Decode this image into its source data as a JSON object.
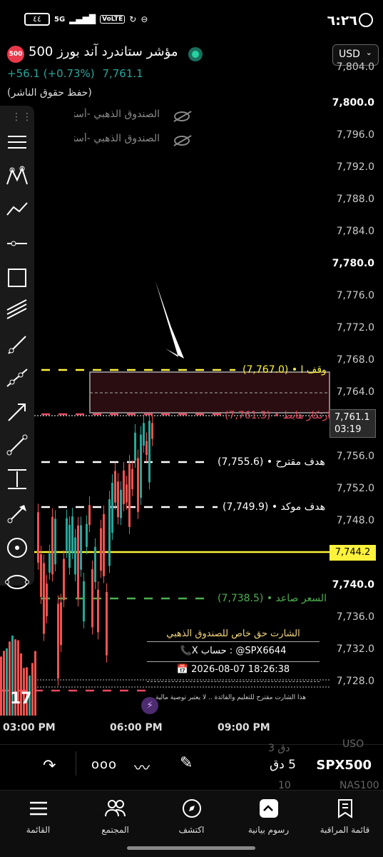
{
  "status_bar": {
    "time": "٦:٢٦",
    "battery": "٤٤",
    "network": "5G",
    "volte": "VoLTE"
  },
  "header": {
    "symbol_badge": "500",
    "title": "مؤشر ستاندرد آند بورز 500",
    "change": "+56.1 (+0.73%)",
    "price": "7,761.1",
    "copyright": "(حفظ حقوق الناشر)",
    "currency": "USD"
  },
  "indicators": [
    {
      "label": "الصندوق الذهبي -أستراتيجيا"
    },
    {
      "label": "الصندوق الذهبي -أستراتيجيا"
    }
  ],
  "toolbar": {
    "tools": [
      "menu-lines-icon",
      "pattern-icon",
      "trend-icon",
      "horizontal-line-icon",
      "rectangle-icon",
      "fib-channel-icon",
      "line-icon",
      "ray-icon",
      "arrow-icon",
      "segment-icon",
      "measure-icon",
      "arrow-marker-icon",
      "circle-target-icon",
      "ellipse-icon"
    ]
  },
  "price_scale": {
    "labels": [
      "7,804.0",
      "7,800.0",
      "7,796.0",
      "7,792.0",
      "7,788.0",
      "7,784.0",
      "7,780.0",
      "7,776.0",
      "7,772.0",
      "7,768.0",
      "7,764.0",
      "7,756.0",
      "7,752.0",
      "7,748.0",
      "7,740.0",
      "7,736.0",
      "7,732.0",
      "7,728.0"
    ],
    "bold_labels": [
      "7,800.0",
      "7,780.0",
      "7,740.0"
    ],
    "current_price": "7,761.1",
    "countdown": "03:19",
    "highlight_price": "7,744.2"
  },
  "levels": {
    "stop": {
      "label": "وقف ا • (7,767.0)",
      "value": 7767.0,
      "color": "#fff23b"
    },
    "current": {
      "label": "ارتكاز هابط • (7,761.3)",
      "value": 7761.3,
      "color": "#e84a5f"
    },
    "target_suggested": {
      "label": "هدف مقترح • (7,755.6)",
      "value": 7755.6,
      "color": "#ffffff"
    },
    "target_confirmed": {
      "label": "هدف موكد • (7,749.9)",
      "value": 7749.9,
      "color": "#ffffff"
    },
    "yellow_line": {
      "value": 7744.2,
      "color": "#fff23b"
    },
    "rising_price": {
      "label": "السعر صاعد • (7,738.5)",
      "value": 7738.5,
      "color": "#4caf50"
    }
  },
  "watermark": {
    "title": "الشارت حق خاص للصندوق الذهبي",
    "account": "📞X حساب :  @SPX6644",
    "datetime": "2026-08-07 18:26:38",
    "note": "هذا الشارت مقترح للتعليم والفائدة .. لا يعتبر توصية مالية"
  },
  "time_axis": [
    "03:00 PM",
    "06:00 PM",
    "09:00 PM"
  ],
  "bottom_panel": {
    "symbol": "SPX500",
    "interval": "5 دق",
    "ghost_items": [
      "USO",
      "3 دق",
      "NAS100",
      "10"
    ]
  },
  "nav": [
    {
      "label": "قائمة المراقبة",
      "icon": "bookmark-list-icon"
    },
    {
      "label": "رسوم بيانية",
      "icon": "chart-icon"
    },
    {
      "label": "اكتشف",
      "icon": "compass-icon"
    },
    {
      "label": "المجتمع",
      "icon": "community-icon"
    },
    {
      "label": "القائمة",
      "icon": "menu-icon"
    }
  ]
}
